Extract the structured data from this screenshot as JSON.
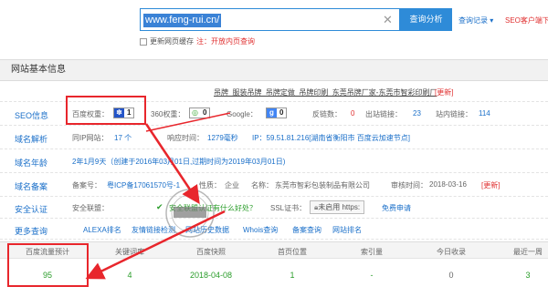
{
  "search": {
    "url": "www.feng-rui.cn/",
    "clear_icon": "close-icon",
    "analyze": "查询分析",
    "history": "查询记录 ▾",
    "seo_client": "SEO客户端下载",
    "refresh_label": "更新网页缓存",
    "refresh_note": "注：开放内页查询"
  },
  "section_title": "网站基本信息",
  "site_title": "吊牌_服装吊牌_吊牌定做_吊牌印刷_东莞吊牌厂家-东莞市智彩印刷厂",
  "site_title_update": "[更新]",
  "seo": {
    "label": "SEO信息",
    "baidu_label": "百度权重：",
    "baidu_value": "1",
    "s360_label": "360权重：",
    "s360_value": "0",
    "google_label": "Google：",
    "google_value": "0",
    "backlinks_label": "反链数：",
    "backlinks_value": "0",
    "outlinks_label": "出站链接：",
    "outlinks_value": "23",
    "inlinks_label": "站内链接：",
    "inlinks_value": "114"
  },
  "dns": {
    "label": "域名解析",
    "same_ip_label": "同IP网站：",
    "same_ip_value": "17 个",
    "resp_label": "响应时间：",
    "resp_value": "1279毫秒",
    "ip_text": "IP：59.51.81.216[湖南省衡阳市 百度云加速节点]"
  },
  "age": {
    "label": "域名年龄",
    "value": "2年1月9天（创建于2016年03月01日,过期时间为2019年03月01日)"
  },
  "icp": {
    "label": "域名备案",
    "num_label": "备案号：",
    "num_value": "粤ICP备17061570号-1",
    "nature_label": "性质：",
    "nature_value": "企业",
    "name_label": "名称：",
    "name_value": "东莞市智彩包装制品有限公司",
    "date_label": "审核时间：",
    "date_value": "2018-03-16",
    "update": "[更新]"
  },
  "security": {
    "label": "安全认证",
    "alliance_label": "安全联盟：",
    "alliance_link": "安全联盟认证有什么好处？",
    "ssl_label": "SSL证书：",
    "https_badge": "未启用 https:",
    "free_link": "免费申请"
  },
  "more": {
    "label": "更多查询",
    "links": [
      "ALEXA排名",
      "友情链接检测",
      "网站历史数据",
      "Whois查询",
      "备案查询",
      "网站排名"
    ]
  },
  "stats": {
    "headers": [
      "百度流量预计",
      "关键词库",
      "百度快照",
      "首页位置",
      "索引量",
      "今日收录",
      "最近一周"
    ],
    "values": [
      "95",
      "4",
      "2018-04-08",
      "1",
      "-",
      "0",
      "3"
    ]
  },
  "stamp_text": "百度权重站长工具",
  "colors": {
    "accent": "#2e8bd8",
    "annotation": "#e8262c",
    "link": "#1a6fc9",
    "green": "#2a9d2a"
  }
}
